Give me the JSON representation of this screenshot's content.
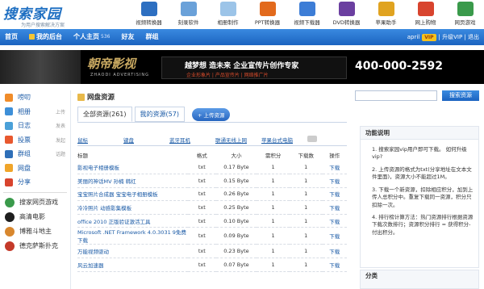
{
  "logo": {
    "name": "搜索家园",
    "slogan": "为用户搜索解决方案"
  },
  "tools": [
    {
      "label": "视频转换器",
      "color": "#2d6fc1"
    },
    {
      "label": "刻录软件",
      "color": "#6aa1d9"
    },
    {
      "label": "相册制作",
      "color": "#9cc4e8"
    },
    {
      "label": "PPT转换器",
      "color": "#e26a1d"
    },
    {
      "label": "视频下载器",
      "color": "#3d7dd6"
    },
    {
      "label": "DVD转换器",
      "color": "#6b3fa0"
    },
    {
      "label": "苹果助手",
      "color": "#e0a320"
    },
    {
      "label": "网上购物",
      "color": "#d8442e"
    },
    {
      "label": "网页游戏",
      "color": "#3a9a4b"
    }
  ],
  "nav": {
    "home": "首页",
    "backend": "我的后台",
    "profile": "个人主页",
    "profile_count": "536",
    "friends": "好友",
    "groups": "群组",
    "user": "april",
    "vip": "VIP",
    "upgrade": "| 升级VIP | 退出"
  },
  "banner": {
    "title": "朝帝影视",
    "subtitle": "ZHAODI ADVERTISING",
    "line1": "越梦想 造未来 企业宣传片创作专家",
    "line2": "企业形象片 | 产品宣传片 | 网络推广片",
    "phone": "400-000-2592"
  },
  "sidebar": {
    "items": [
      {
        "label": "唠叨",
        "action": "",
        "color": "#f08c2a"
      },
      {
        "label": "相册",
        "action": "上传",
        "color": "#3d8fd8"
      },
      {
        "label": "日志",
        "action": "发表",
        "color": "#4aa0d8"
      },
      {
        "label": "投票",
        "action": "发起",
        "color": "#e8582e"
      },
      {
        "label": "群组",
        "action": "话题",
        "color": "#2e6fb8"
      },
      {
        "label": "网盘",
        "action": "",
        "color": "#f0a52a"
      },
      {
        "label": "分享",
        "action": "",
        "color": "#d8442e"
      }
    ],
    "apps": [
      {
        "label": "搜家网页游戏",
        "color": "#3a9a4b"
      },
      {
        "label": "高清电影",
        "color": "#1e1e1e"
      },
      {
        "label": "博雅斗地主",
        "color": "#d8872e"
      },
      {
        "label": "德克萨斯扑克",
        "color": "#c43a2a"
      }
    ]
  },
  "main": {
    "section": "网盘资源",
    "tab_all": "全部资源(261)",
    "tab_mine": "我的资源(57)",
    "upload": "+ 上传资源",
    "categories": [
      "鼠标",
      "键盘",
      "蓝牙耳机",
      "联通无线上网",
      "苹果台式电脑"
    ],
    "columns": [
      "标题",
      "格式",
      "大小",
      "需积分",
      "下载数",
      "操作"
    ],
    "rows": [
      {
        "title": "影视电子相册模板",
        "fmt": "txt",
        "size": "0.17 Byte",
        "pts": "1",
        "dl": "1",
        "op": "下载"
      },
      {
        "title": "美丽的神话MV 孙楠 韩红",
        "fmt": "txt",
        "size": "0.15 Byte",
        "pts": "1",
        "dl": "1",
        "op": "下载"
      },
      {
        "title": "宝宝照片合成器 宝宝电子相册模板",
        "fmt": "txt",
        "size": "0.26 Byte",
        "pts": "1",
        "dl": "1",
        "op": "下载"
      },
      {
        "title": "冷冷照片 动感影集模板",
        "fmt": "txt",
        "size": "0.25 Byte",
        "pts": "1",
        "dl": "1",
        "op": "下载"
      },
      {
        "title": "office 2010 正版验证激活工具",
        "fmt": "txt",
        "size": "0.10 Byte",
        "pts": "1",
        "dl": "1",
        "op": "下载"
      },
      {
        "title": "Microsoft .NET Framework 4.0.3031 9免费下载",
        "fmt": "txt",
        "size": "0.09 Byte",
        "pts": "1",
        "dl": "1",
        "op": "下载"
      },
      {
        "title": "万能视频驱动",
        "fmt": "txt",
        "size": "0.23 Byte",
        "pts": "1",
        "dl": "1",
        "op": "下载"
      },
      {
        "title": "风云加速器",
        "fmt": "txt",
        "size": "0.07 Byte",
        "pts": "1",
        "dl": "1",
        "op": "下载"
      }
    ]
  },
  "right": {
    "search_btn": "搜索资源",
    "help_title": "功能说明",
    "help": [
      "1. 搜索家园vip用户即可下载。 如何升级vip?",
      "2. 上传资源的格式为txt(分享地址在文本文件里面)，资源大小不能超过1M。",
      "3. 下载一个新资源，扣除相应积分，加到上传人总积分中。重复下载同一资源，积分只扣除一次。",
      "4. 排行榜计算方法：热门资源排行根据资源下载次数排行；资源积分排行 = 获得积分-付出积分。"
    ],
    "cat_title": "分类"
  }
}
